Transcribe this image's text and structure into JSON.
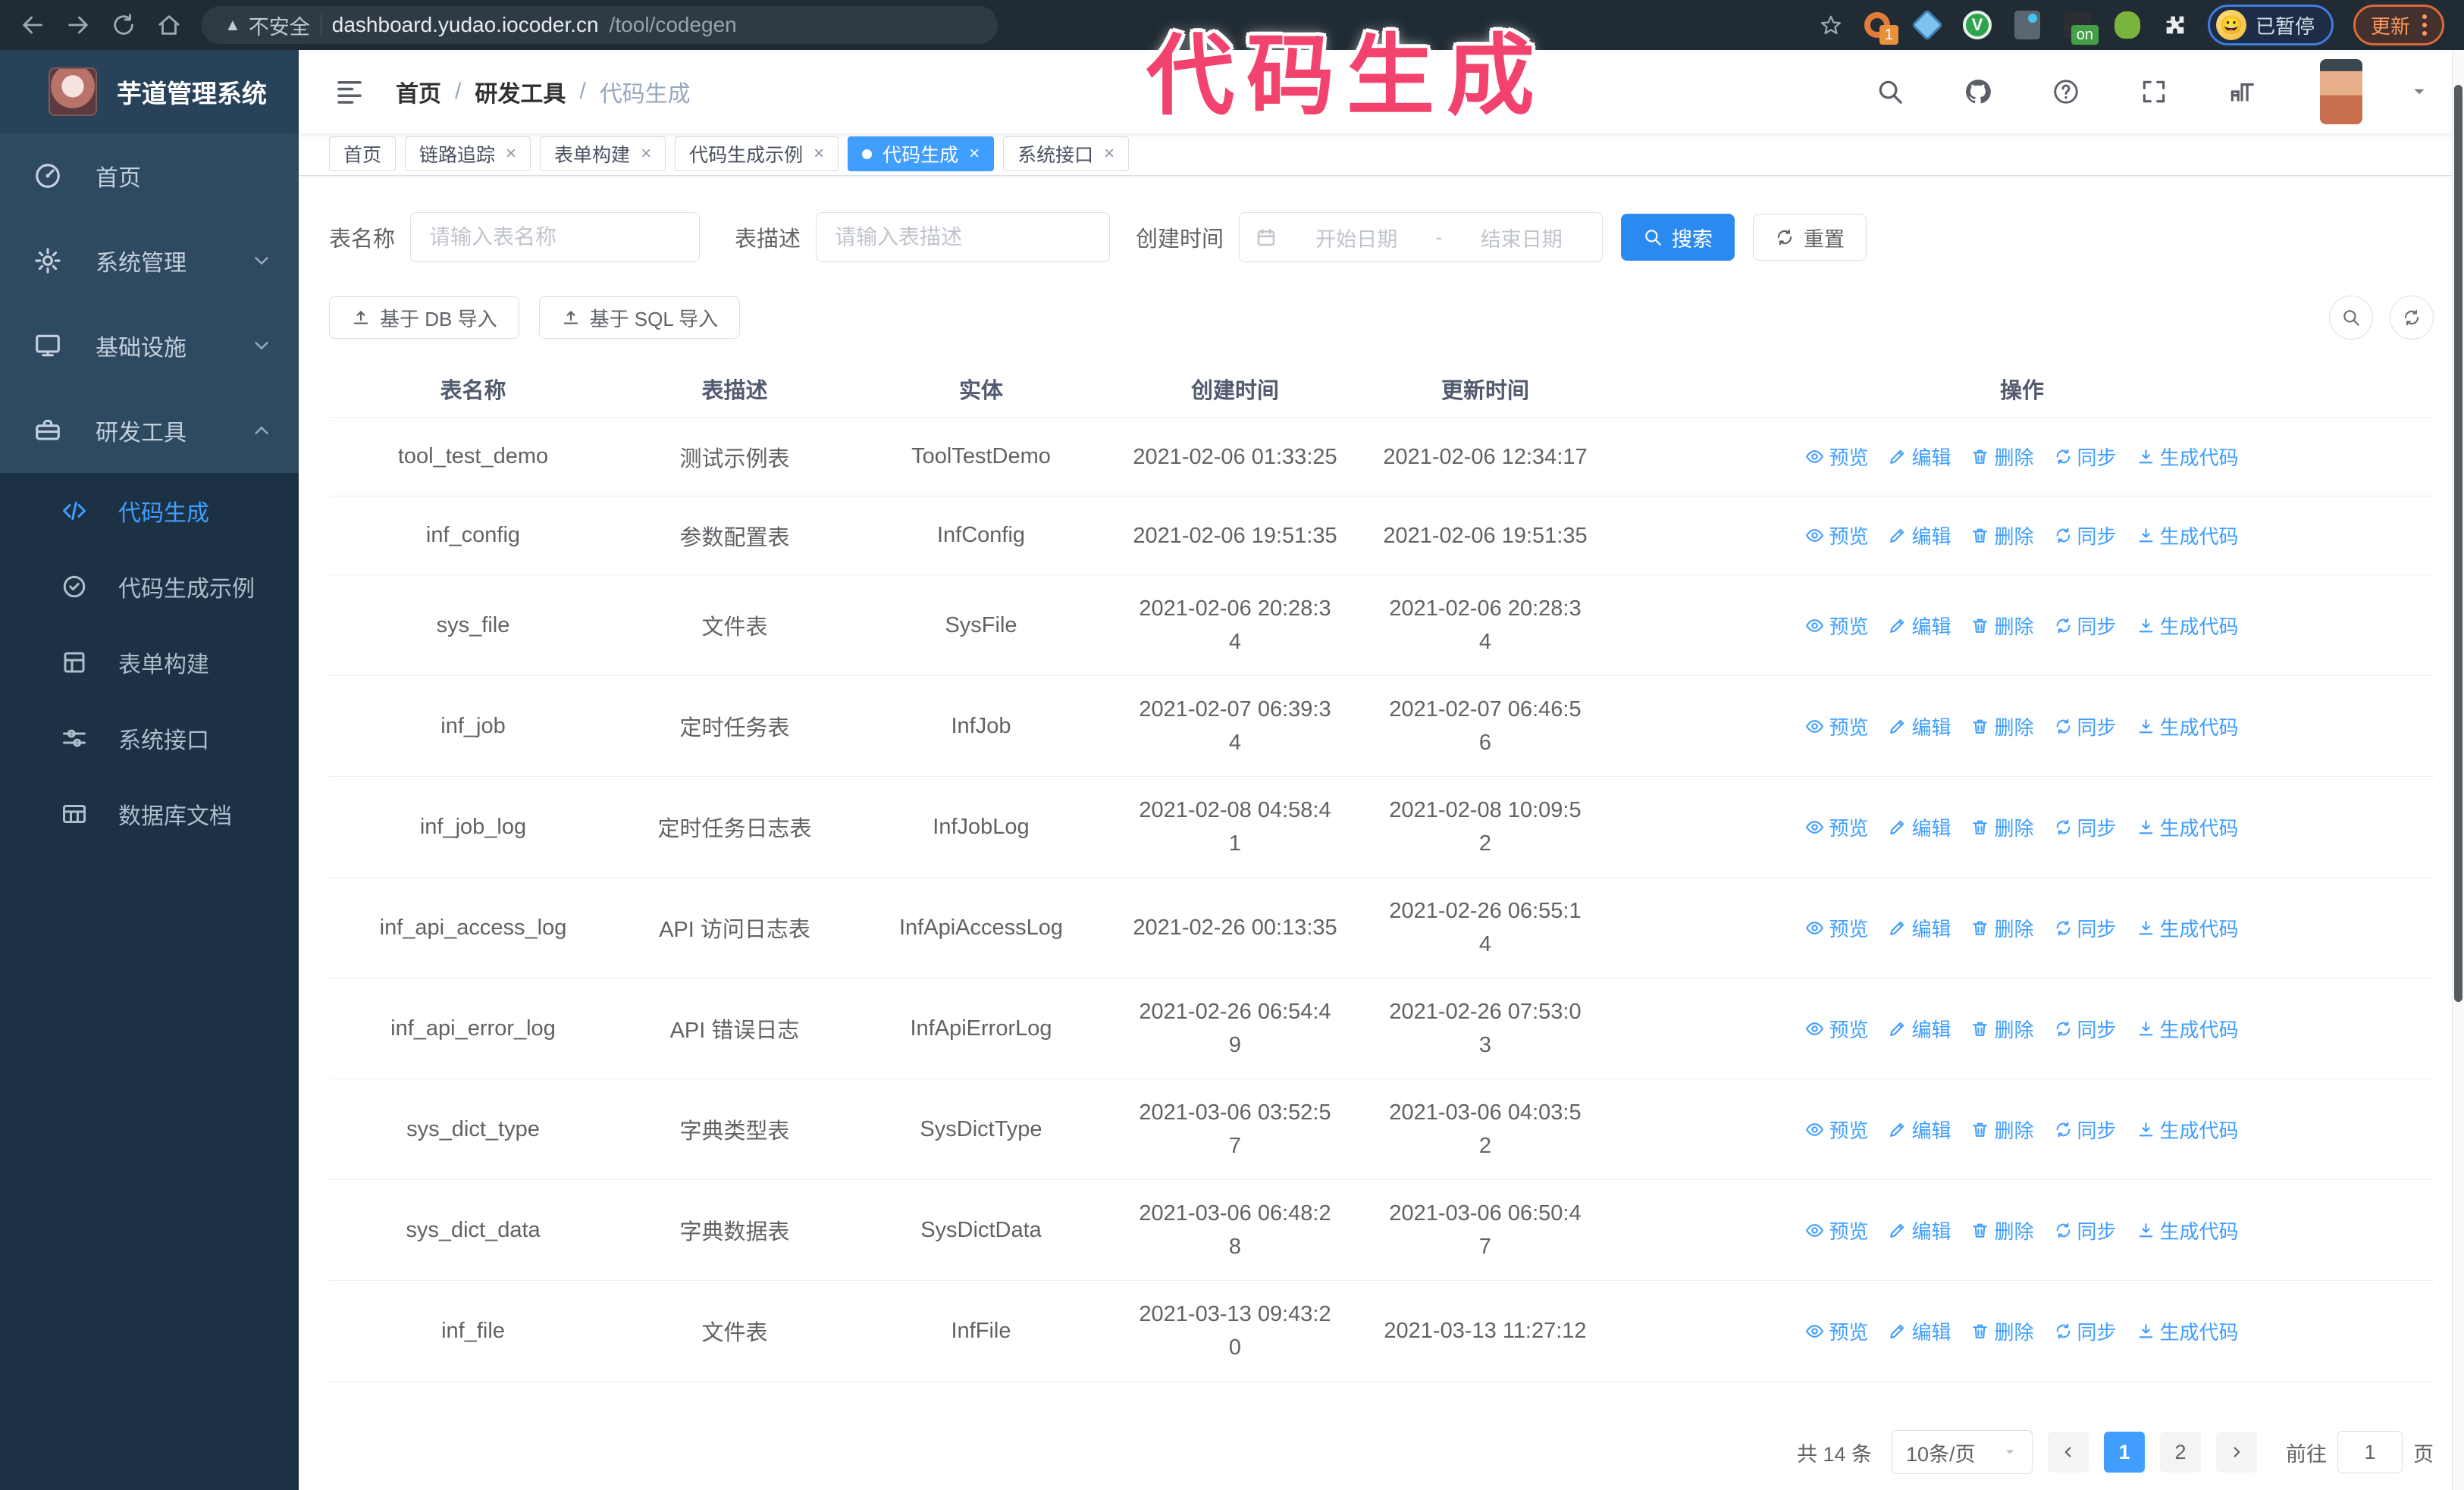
{
  "browser": {
    "security_label": "不安全",
    "url_host": "dashboard.yudao.iocoder.cn",
    "url_path": "/tool/codegen",
    "ext_badge_count": "1",
    "ext_badge_on": "on",
    "ext_v_letter": "V",
    "profile_emoji": "😀",
    "profile_label": "已暂停",
    "update_label": "更新"
  },
  "overlay_title": "代码生成",
  "icons": {
    "close": "×",
    "warning": "▲"
  },
  "sidebar": {
    "logo_title": "芋道管理系统",
    "items": [
      {
        "label": "首页"
      },
      {
        "label": "系统管理"
      },
      {
        "label": "基础设施"
      },
      {
        "label": "研发工具"
      }
    ],
    "sub_items": [
      {
        "label": "代码生成"
      },
      {
        "label": "代码生成示例"
      },
      {
        "label": "表单构建"
      },
      {
        "label": "系统接口"
      },
      {
        "label": "数据库文档"
      }
    ]
  },
  "header": {
    "breadcrumb": [
      "首页",
      "研发工具",
      "代码生成"
    ],
    "separator": "/"
  },
  "tabs": [
    {
      "label": "首页"
    },
    {
      "label": "链路追踪"
    },
    {
      "label": "表单构建"
    },
    {
      "label": "代码生成示例"
    },
    {
      "label": "代码生成"
    },
    {
      "label": "系统接口"
    }
  ],
  "filters": {
    "name_label": "表名称",
    "name_placeholder": "请输入表名称",
    "desc_label": "表描述",
    "desc_placeholder": "请输入表描述",
    "time_label": "创建时间",
    "start_placeholder": "开始日期",
    "range_separator": "-",
    "end_placeholder": "结束日期",
    "search_label": "搜索",
    "reset_label": "重置"
  },
  "toolbar": {
    "import_db_label": "基于 DB 导入",
    "import_sql_label": "基于 SQL 导入"
  },
  "table": {
    "columns": [
      "表名称",
      "表描述",
      "实体",
      "创建时间",
      "更新时间",
      "操作"
    ],
    "op_labels": [
      "预览",
      "编辑",
      "删除",
      "同步",
      "生成代码"
    ],
    "rows": [
      {
        "name": "tool_test_demo",
        "desc": "测试示例表",
        "entity": "ToolTestDemo",
        "created": "2021-02-06 01:33:25",
        "updated": "2021-02-06 12:34:17"
      },
      {
        "name": "inf_config",
        "desc": "参数配置表",
        "entity": "InfConfig",
        "created": "2021-02-06 19:51:35",
        "updated": "2021-02-06 19:51:35"
      },
      {
        "name": "sys_file",
        "desc": "文件表",
        "entity": "SysFile",
        "created": "2021-02-06 20:28:3\n4",
        "updated": "2021-02-06 20:28:3\n4"
      },
      {
        "name": "inf_job",
        "desc": "定时任务表",
        "entity": "InfJob",
        "created": "2021-02-07 06:39:3\n4",
        "updated": "2021-02-07 06:46:5\n6"
      },
      {
        "name": "inf_job_log",
        "desc": "定时任务日志表",
        "entity": "InfJobLog",
        "created": "2021-02-08 04:58:4\n1",
        "updated": "2021-02-08 10:09:5\n2"
      },
      {
        "name": "inf_api_access_log",
        "desc": "API 访问日志表",
        "entity": "InfApiAccessLog",
        "created": "2021-02-26 00:13:35",
        "updated": "2021-02-26 06:55:1\n4"
      },
      {
        "name": "inf_api_error_log",
        "desc": "API 错误日志",
        "entity": "InfApiErrorLog",
        "created": "2021-02-26 06:54:4\n9",
        "updated": "2021-02-26 07:53:0\n3"
      },
      {
        "name": "sys_dict_type",
        "desc": "字典类型表",
        "entity": "SysDictType",
        "created": "2021-03-06 03:52:5\n7",
        "updated": "2021-03-06 04:03:5\n2"
      },
      {
        "name": "sys_dict_data",
        "desc": "字典数据表",
        "entity": "SysDictData",
        "created": "2021-03-06 06:48:2\n8",
        "updated": "2021-03-06 06:50:4\n7"
      },
      {
        "name": "inf_file",
        "desc": "文件表",
        "entity": "InfFile",
        "created": "2021-03-13 09:43:2\n0",
        "updated": "2021-03-13 11:27:12"
      }
    ]
  },
  "pagination": {
    "total": "共 14 条",
    "page_size": "10条/页",
    "pages": [
      "1",
      "2"
    ],
    "goto_label": "前往",
    "goto_value": "1",
    "goto_suffix": "页"
  },
  "colors": {
    "accent": "#409eff",
    "overlay_pink": "#f2436e",
    "sidebar_dark": "#1d3145",
    "sidebar_top": "#2e4a60"
  }
}
